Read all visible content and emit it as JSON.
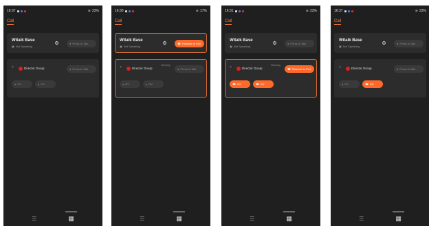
{
  "screens": [
    {
      "status_time": "16:37",
      "status_right": "23%",
      "call_tab": "Call",
      "base": {
        "title": "Witalk Base",
        "subtitle": "Not Speaking",
        "action": "Press to Talk",
        "active": false
      },
      "group": {
        "name": "Director Group",
        "state": "",
        "action": "Press to Talk",
        "active": false,
        "chips": [
          {
            "label": "RX",
            "active": false
          },
          {
            "label": "RX",
            "active": false
          }
        ]
      }
    },
    {
      "status_time": "16:30",
      "status_right": "17%",
      "call_tab": "Call",
      "base": {
        "title": "Witalk Base",
        "subtitle": "Not Speaking",
        "action": "Release to End",
        "active": true
      },
      "group": {
        "name": "Director Group",
        "state": "Sleeping",
        "action": "Press to Talk",
        "active": true,
        "chips": [
          {
            "label": "RX",
            "active": false
          },
          {
            "label": "RX",
            "active": false
          }
        ]
      }
    },
    {
      "status_time": "16:31",
      "status_right": "23%",
      "call_tab": "Call",
      "base": {
        "title": "Witalk Base",
        "subtitle": "Not Speaking",
        "action": "Press to Talk",
        "active": false
      },
      "group": {
        "name": "Director Group",
        "state": "Sleeping",
        "action": "Release to End",
        "active": true,
        "chips": [
          {
            "label": "RX",
            "active": true
          },
          {
            "label": "RX",
            "active": true
          }
        ]
      }
    },
    {
      "status_time": "16:37",
      "status_right": "23%",
      "call_tab": "Call",
      "base": {
        "title": "Witalk Base",
        "subtitle": "Not Speaking",
        "action": "Press to Talk",
        "active": false
      },
      "group": {
        "name": "Director Group",
        "state": "",
        "action": "Press to Talk",
        "active": false,
        "chips": [
          {
            "label": "RX",
            "active": false
          },
          {
            "label": "RX",
            "active": true
          }
        ]
      }
    }
  ],
  "icons": {
    "settings": "gear-icon",
    "mic": "microphone-icon",
    "phone": "phone-icon",
    "expand": "chevron-up-icon",
    "nav_list": "list-icon",
    "nav_grid": "grid-icon"
  },
  "colors": {
    "accent": "#ff6a2a",
    "record": "#e01e1e",
    "background": "#1f1f1f",
    "card": "#2c2c2c"
  }
}
